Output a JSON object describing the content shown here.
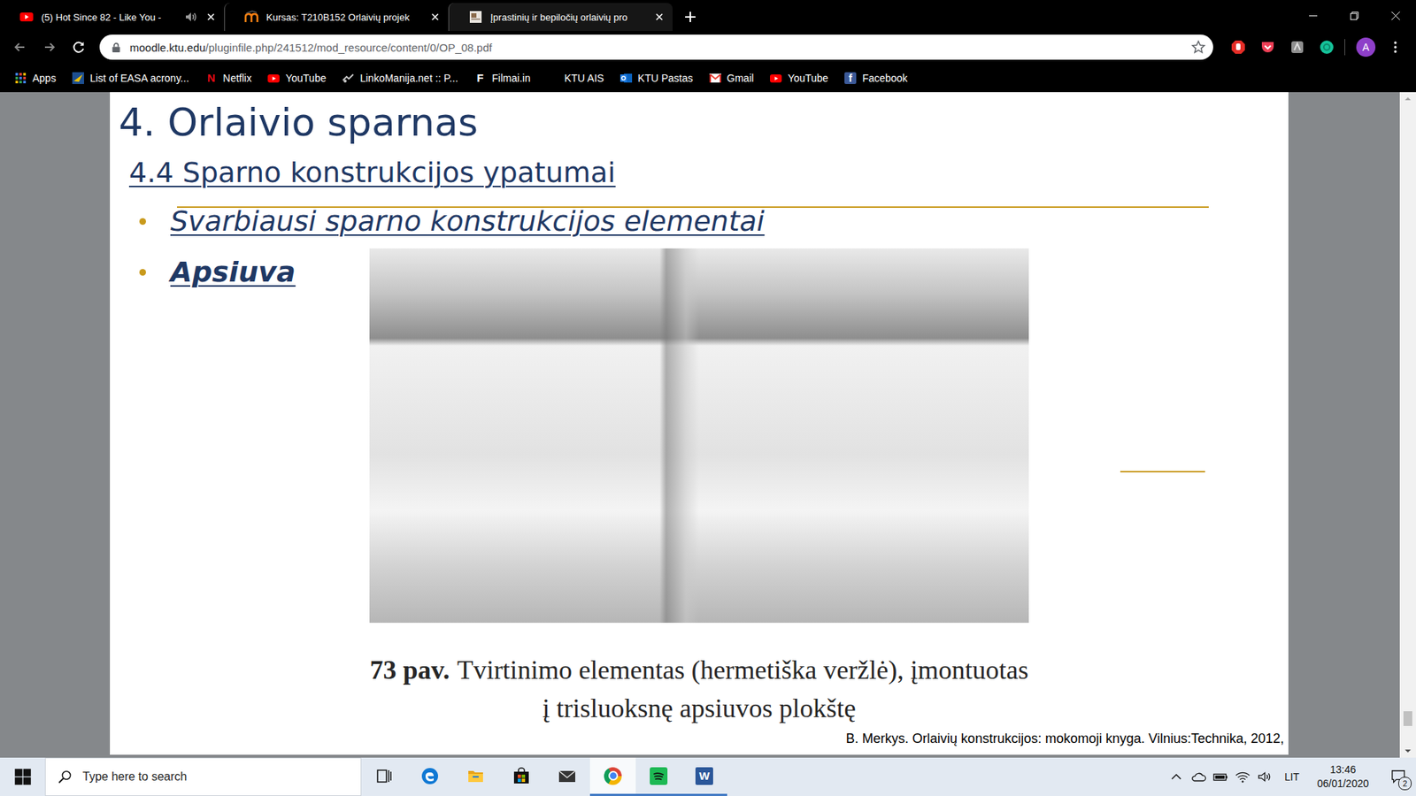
{
  "window": {
    "tabs": [
      {
        "label": "(5) Hot Since 82 - Like You -",
        "kind": "youtube",
        "audio": true,
        "selected": false
      },
      {
        "label": "Kursas: T210B152 Orlaivių projek",
        "kind": "moodle",
        "audio": false,
        "selected": false
      },
      {
        "label": "Įprastinių ir bepiločių orlaivių pro",
        "kind": "pdf",
        "audio": false,
        "selected": true
      }
    ]
  },
  "toolbar": {
    "url_host": "moodle.ktu.edu",
    "url_path": "/pluginfile.php/241512/mod_resource/content/0/OP_08.pdf",
    "bookmarked": false,
    "avatar": "A"
  },
  "bookmarks": [
    {
      "label": "Apps",
      "kind": "apps"
    },
    {
      "label": "List of EASA acrony...",
      "kind": "easa"
    },
    {
      "label": "Netflix",
      "kind": "netflix",
      "icon_text": "N"
    },
    {
      "label": "YouTube",
      "kind": "youtube"
    },
    {
      "label": "LinkoManija.net :: P...",
      "kind": "linko"
    },
    {
      "label": "Filmai.in",
      "kind": "letter",
      "icon_text": "F"
    },
    {
      "label": "KTU AIS",
      "kind": "blank"
    },
    {
      "label": "KTU Pastas",
      "kind": "outlook"
    },
    {
      "label": "Gmail",
      "kind": "gmail"
    },
    {
      "label": "YouTube",
      "kind": "youtube"
    },
    {
      "label": "Facebook",
      "kind": "facebook",
      "icon_text": "f"
    }
  ],
  "document": {
    "title": "4. Orlaivio sparnas",
    "section": "4.4 Sparno konstrukcijos ypatumai",
    "bullets": [
      {
        "text": "Svarbiausi sparno konstrukcijos elementai",
        "bold": false
      },
      {
        "text": "Apsiuva",
        "bold": true
      }
    ],
    "figure": {
      "number": "73 pav.",
      "caption": [
        "Tvirtinimo elementas (hermetiška veržlė), įmontuotas",
        "į trisluoksnę apsiuvos plokštę"
      ]
    },
    "source": "B. Merkys. Orlaivių konstrukcijos: mokomoji knyga. Vilnius:Technika, 2012,"
  },
  "scrollbar": {
    "level": 0.97
  },
  "taskbar": {
    "search_placeholder": "Type here to search",
    "apps": [
      {
        "kind": "taskview",
        "running": false,
        "selected": false
      },
      {
        "kind": "edge",
        "running": false,
        "selected": false
      },
      {
        "kind": "explorer",
        "running": false,
        "selected": false
      },
      {
        "kind": "store",
        "running": false,
        "selected": false
      },
      {
        "kind": "mail",
        "running": false,
        "selected": false
      },
      {
        "kind": "chrome",
        "running": true,
        "selected": true
      },
      {
        "kind": "spotify",
        "running": true,
        "selected": false
      },
      {
        "kind": "word",
        "running": true,
        "selected": false,
        "icon_text": "W"
      }
    ],
    "language": "LIT",
    "time": "13:46",
    "date": "06/01/2020",
    "notifications": "2"
  }
}
